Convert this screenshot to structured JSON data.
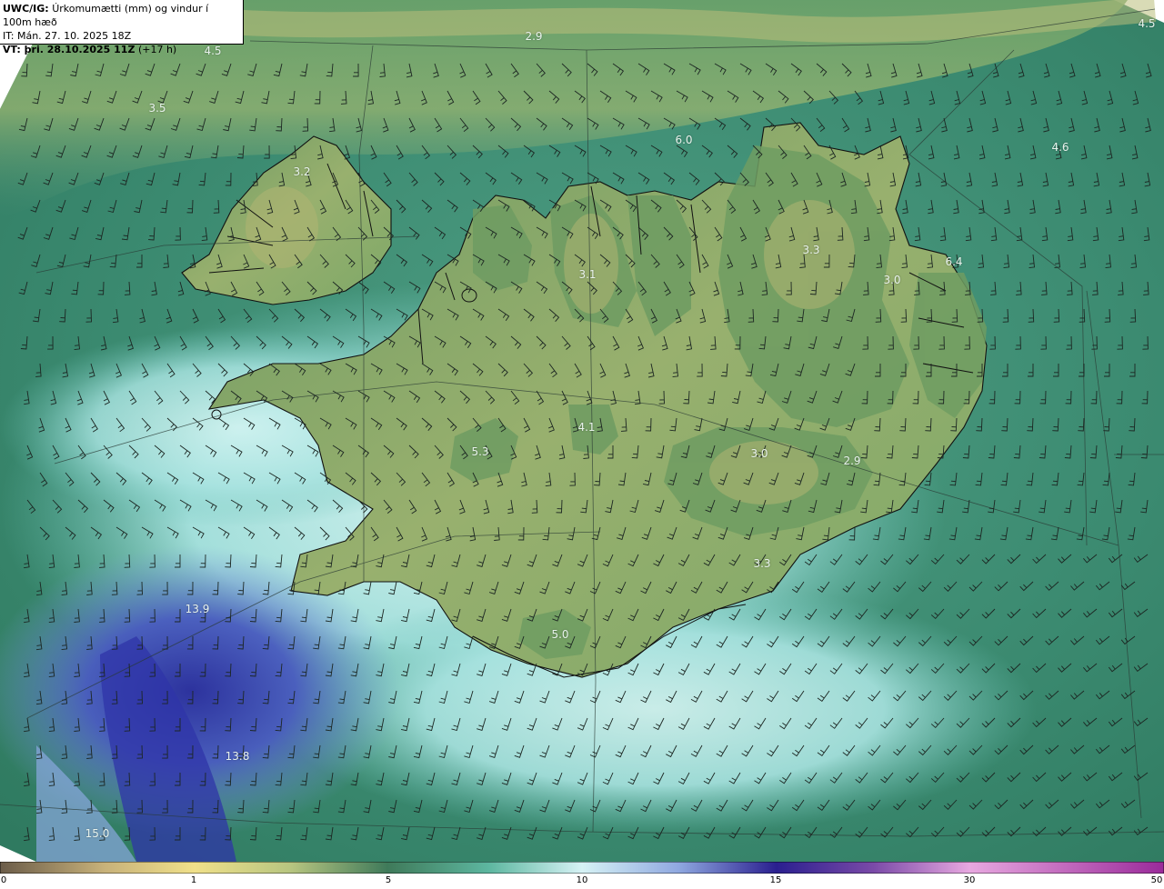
{
  "header": {
    "product_bold": "UWC/IG:",
    "product_title": "Úrkomumætti (mm) og vindur í 100m hæð",
    "init_time": "IT: Mán. 27. 10. 2025 18Z",
    "valid_bold": "VT: þri. 28.10.2025 11Z",
    "valid_offset": "(+17 h)"
  },
  "value_labels": [
    {
      "text": "2.9"
    },
    {
      "text": "4.5"
    },
    {
      "text": "4.5"
    },
    {
      "text": "3.5"
    },
    {
      "text": "6.0"
    },
    {
      "text": "4.6"
    },
    {
      "text": "3.2"
    },
    {
      "text": "3.3"
    },
    {
      "text": "3.0"
    },
    {
      "text": "6.4"
    },
    {
      "text": "3.1"
    },
    {
      "text": "4.1"
    },
    {
      "text": "5.3"
    },
    {
      "text": "3.0"
    },
    {
      "text": "2.9"
    },
    {
      "text": "3.3"
    },
    {
      "text": "5.0"
    },
    {
      "text": "13.9"
    },
    {
      "text": "13.8"
    },
    {
      "text": "15.0"
    }
  ],
  "colorbar": {
    "unit": "mm",
    "ticks": [
      "0",
      "1",
      "5",
      "10",
      "15",
      "30",
      "50"
    ],
    "colors": [
      "#6b5c49",
      "#c8b27a",
      "#f0e08a",
      "#3f7a5a",
      "#8fd9d8",
      "#d6f2f5",
      "#6a78c8",
      "#2a1f8f",
      "#b070c8",
      "#e8a8e0",
      "#9a2a9a"
    ]
  },
  "map_colors": {
    "sea_light": "#b8ece9",
    "sea_teal": "#2f8a6a",
    "sea_blue": "#3d4fb0",
    "land_green": "#7aa36a",
    "land_olive": "#a6b66e",
    "coast": "#000000"
  }
}
